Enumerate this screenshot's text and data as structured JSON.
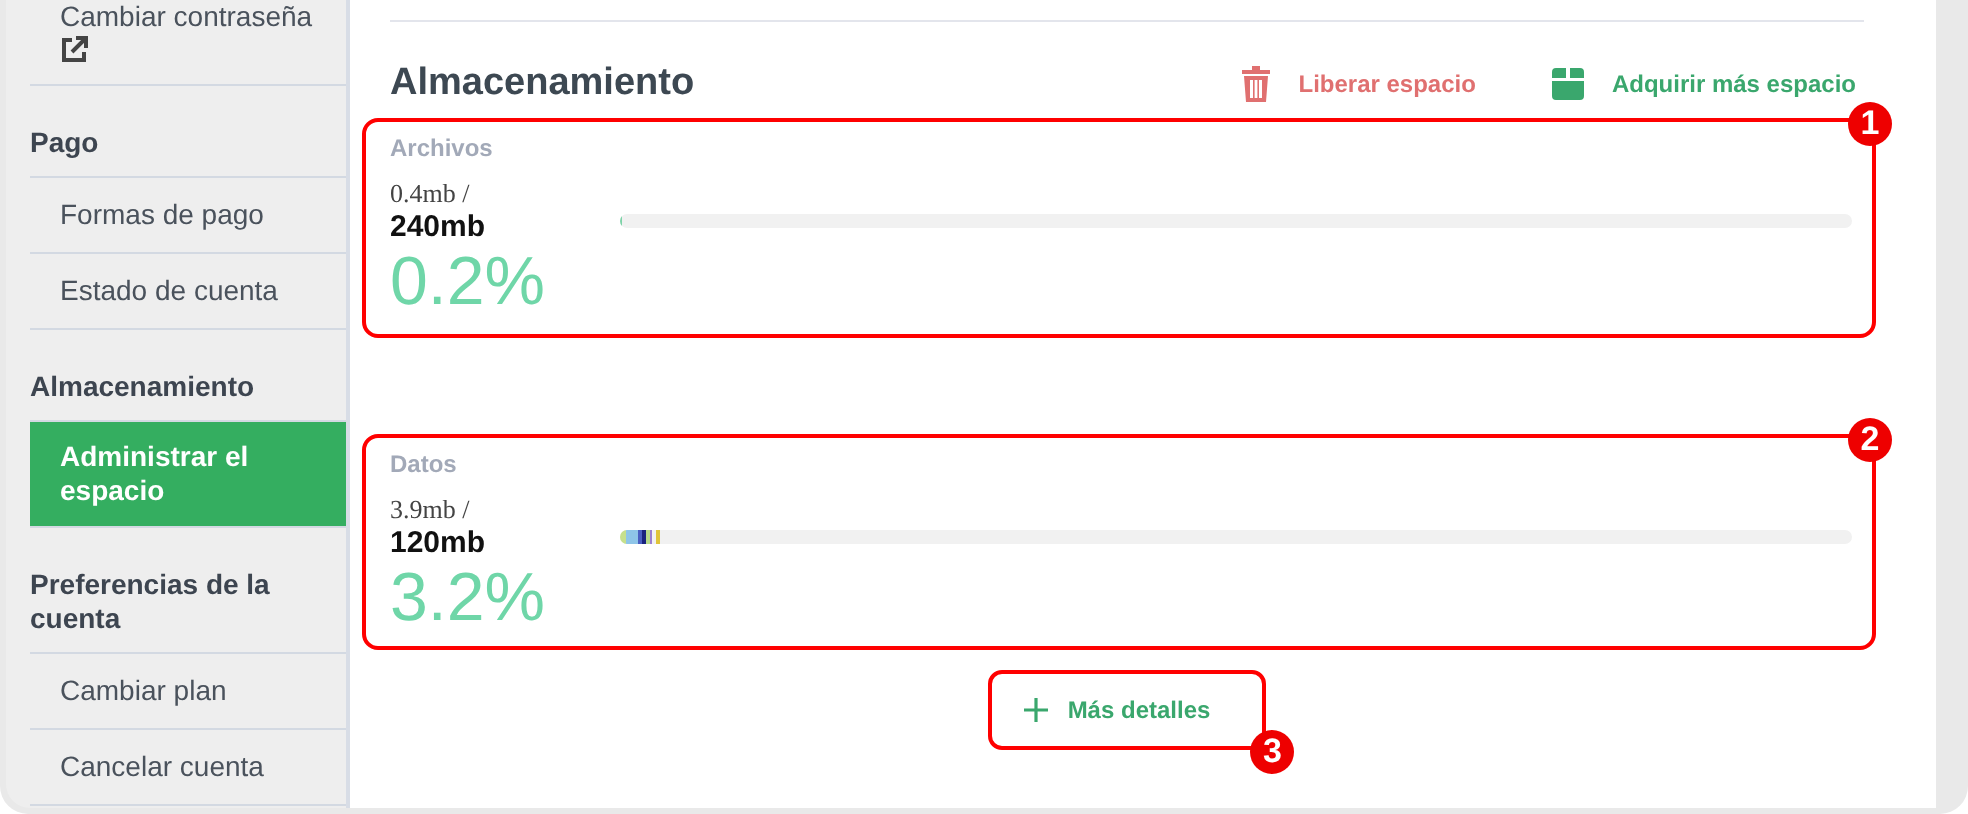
{
  "sidebar": {
    "groups": [
      {
        "items": [
          {
            "label": "Cambiar contraseña",
            "external": true,
            "selected": false
          }
        ]
      },
      {
        "heading": "Pago",
        "items": [
          {
            "label": "Formas de pago",
            "external": false,
            "selected": false
          },
          {
            "label": "Estado de cuenta",
            "external": false,
            "selected": false
          }
        ]
      },
      {
        "heading": "Almacenamiento",
        "items": [
          {
            "label": "Administrar el espacio",
            "external": false,
            "selected": true
          }
        ]
      },
      {
        "heading": "Preferencias de la cuenta",
        "items": [
          {
            "label": "Cambiar plan",
            "external": false,
            "selected": false
          },
          {
            "label": "Cancelar cuenta",
            "external": false,
            "selected": false
          }
        ]
      }
    ]
  },
  "main": {
    "title": "Almacenamiento",
    "actions": [
      {
        "kind": "delete",
        "label": "Liberar espacio"
      },
      {
        "kind": "buy",
        "label": "Adquirir más espacio"
      }
    ],
    "meters": [
      {
        "label": "Archivos",
        "used": "0.4mb /",
        "total": "240mb",
        "percent": "0.2%",
        "badge": "1",
        "segments": [
          {
            "level": 0.002,
            "color": "#7dd3a8"
          }
        ]
      },
      {
        "label": "Datos",
        "used": "3.9mb /",
        "total": "120mb",
        "percent": "3.2%",
        "badge": "2",
        "segments": [
          {
            "level": 0.005,
            "color": "#c6e08c"
          },
          {
            "level": 0.009,
            "color": "#8ec5e8"
          },
          {
            "level": 0.004,
            "color": "#4a5fc1"
          },
          {
            "level": 0.003,
            "color": "#1a237e"
          },
          {
            "level": 0.003,
            "color": "#b8d98a"
          },
          {
            "level": 0.002,
            "color": "#9c7fd0"
          },
          {
            "level": 0.003,
            "color": "#f2f2f2"
          },
          {
            "level": 0.003,
            "color": "#e0c43a"
          }
        ]
      }
    ],
    "details_button": {
      "label": "Más detalles",
      "badge": "3"
    }
  }
}
